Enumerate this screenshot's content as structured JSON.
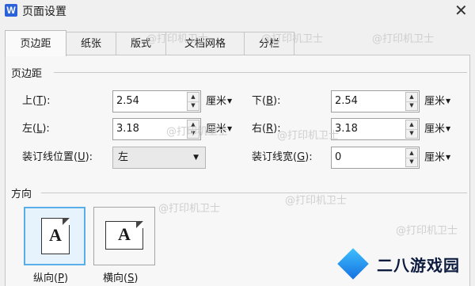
{
  "window": {
    "icon_letter": "W",
    "title": "页面设置",
    "close": "✕"
  },
  "tabs": [
    {
      "label": "页边距",
      "active": true
    },
    {
      "label": "纸张"
    },
    {
      "label": "版式"
    },
    {
      "label": "文档网格"
    },
    {
      "label": "分栏"
    }
  ],
  "margins": {
    "section_title": "页边距",
    "top": {
      "label": "上",
      "key": "T",
      "value": "2.54",
      "unit": "厘米"
    },
    "bottom": {
      "label": "下",
      "key": "B",
      "value": "2.54",
      "unit": "厘米"
    },
    "left": {
      "label": "左",
      "key": "L",
      "value": "3.18",
      "unit": "厘米"
    },
    "right": {
      "label": "右",
      "key": "R",
      "value": "3.18",
      "unit": "厘米"
    },
    "gutter_pos": {
      "label": "装订线位置",
      "key": "U",
      "value": "左"
    },
    "gutter_width": {
      "label": "装订线宽",
      "key": "G",
      "value": "0",
      "unit": "厘米"
    }
  },
  "orientation": {
    "section_title": "方向",
    "portrait": {
      "label": "纵向",
      "key": "P",
      "icon_letter": "A",
      "selected": true
    },
    "landscape": {
      "label": "横向",
      "key": "S",
      "icon_letter": "A"
    }
  },
  "watermark": "@打印机卫士",
  "logo": {
    "text": "二八游戏园"
  }
}
